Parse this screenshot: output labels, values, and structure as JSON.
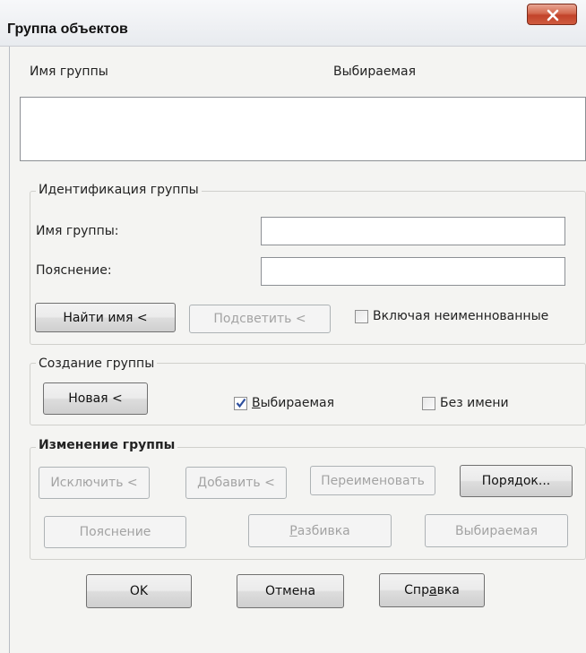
{
  "window": {
    "title": "Группа объектов"
  },
  "list": {
    "col_name": "Имя группы",
    "col_selectable": "Выбираемая"
  },
  "identification": {
    "legend": "Идентификация группы",
    "name_label": "Имя группы:",
    "name_value": "",
    "desc_label": "Пояснение:",
    "desc_value": "",
    "find_name_button": "Найти имя <",
    "highlight_button": "Подсветить <",
    "include_unnamed_label": "Включая неименнованные",
    "include_unnamed_checked": false
  },
  "create": {
    "legend": "Создание группы",
    "new_button": "Новая <",
    "selectable_label": "Выбираемая",
    "selectable_checked": true,
    "unnamed_label": "Без имени",
    "unnamed_checked": false
  },
  "modify": {
    "legend": "Изменение группы",
    "exclude_button": "Исключить <",
    "add_button": "Добавить <",
    "rename_button": "Переименовать",
    "order_button": "Порядок...",
    "description_button": "Пояснение",
    "explode_button": "Разбивка",
    "selectable_button": "Выбираемая"
  },
  "footer": {
    "ok": "OK",
    "cancel": "Отмена",
    "help": "Справка"
  }
}
